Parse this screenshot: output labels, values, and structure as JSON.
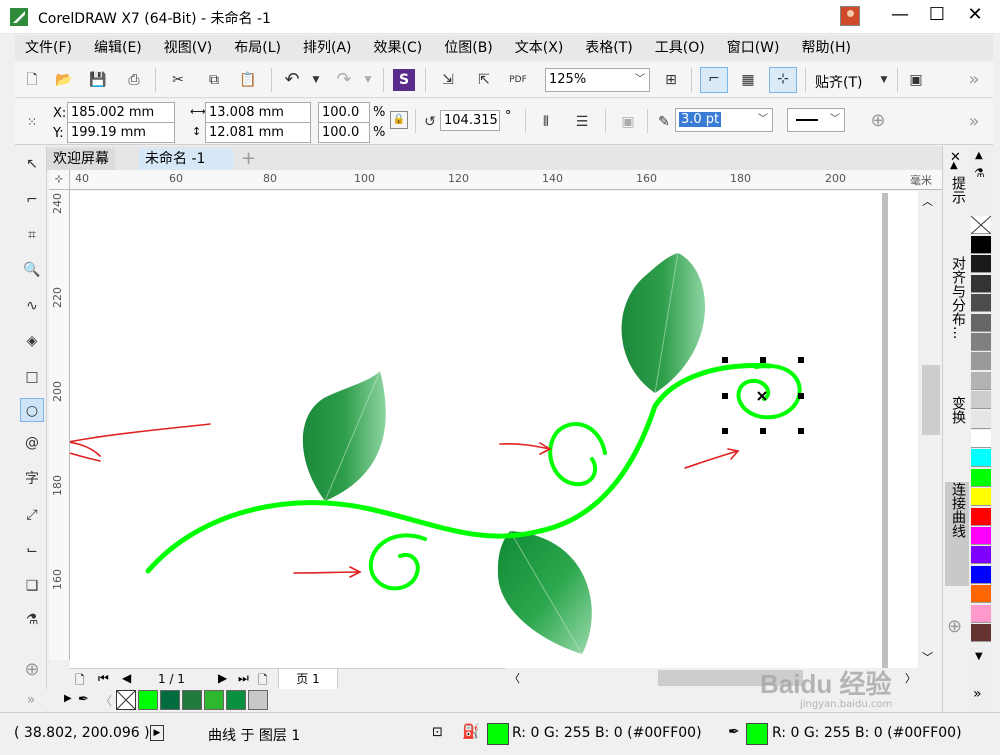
{
  "window": {
    "title": "CorelDRAW X7 (64-Bit) - 未命名 -1",
    "minimize": "—",
    "maximize": "☐",
    "close": "✕"
  },
  "menu": [
    "文件(F)",
    "编辑(E)",
    "视图(V)",
    "布局(L)",
    "排列(A)",
    "效果(C)",
    "位图(B)",
    "文本(X)",
    "表格(T)",
    "工具(O)",
    "窗口(W)",
    "帮助(H)"
  ],
  "toolbar": {
    "zoom": "125%",
    "snap_label": "贴齐(T)",
    "more": "»"
  },
  "property_bar": {
    "x_label": "X:",
    "x_value": "185.002 mm",
    "y_label": "Y:",
    "y_value": "199.19 mm",
    "width_value": "13.008 mm",
    "height_value": "12.081 mm",
    "scale_w": "100.0",
    "scale_h": "100.0",
    "percent": "%",
    "rotation_value": "104.315",
    "degree": "°",
    "outline_width": "3.0 pt",
    "more": "»"
  },
  "tabs": [
    {
      "label": "欢迎屏幕"
    },
    {
      "label": "未命名 -1"
    }
  ],
  "tab_add": "+",
  "ruler": {
    "h_ticks": [
      "40",
      "60",
      "80",
      "100",
      "120",
      "140",
      "160",
      "180",
      "200"
    ],
    "v_ticks": [
      "240",
      "220",
      "200",
      "180",
      "160"
    ],
    "unit": "毫米"
  },
  "page_nav": {
    "current": "1 / 1",
    "page_tab": "页 1"
  },
  "dockers": [
    "提示",
    "对齐与分布...",
    "变换",
    "连接曲线"
  ],
  "palette_colors": [
    "#000000",
    "#1a1a1a",
    "#333333",
    "#4d4d4d",
    "#666666",
    "#808080",
    "#999999",
    "#b3b3b3",
    "#cccccc",
    "#e6e6e6",
    "#ffffff",
    "#00ffff",
    "#00ff00",
    "#ffff00",
    "#ff0000",
    "#ff00ff",
    "#8000ff",
    "#0000ff",
    "#ff6600",
    "#ff99cc",
    "#663333"
  ],
  "doc_palette_colors": [
    "#00ff00",
    "#006b3c",
    "#1e7b3c",
    "#2eb82e",
    "#0a8f3c",
    "#c8c8c8"
  ],
  "status": {
    "coords": "( 38.802, 200.096 )",
    "object_info": "曲线 于 图层 1",
    "fill_info": "R: 0 G: 255 B: 0 (#00FF00)",
    "outline_info": "R: 0 G: 255 B: 0 (#00FF00)",
    "fill_color": "#00FF00",
    "outline_color": "#00FF00"
  },
  "watermark": {
    "line1": "Baidu 经验",
    "line2": "jingyan.baidu.com"
  }
}
